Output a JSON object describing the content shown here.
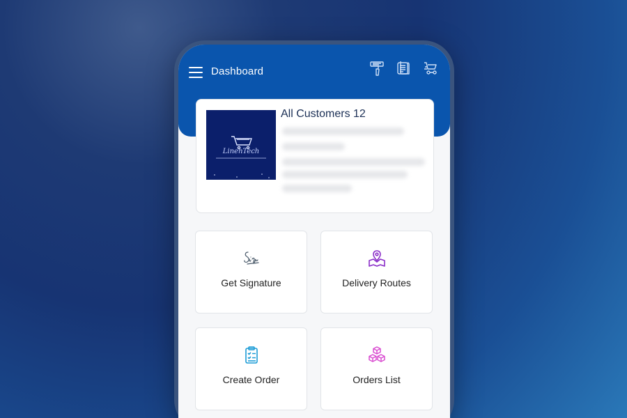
{
  "header": {
    "title": "Dashboard",
    "menu_icon": "hamburger-menu-icon",
    "actions": [
      {
        "name": "scanner-icon"
      },
      {
        "name": "notes-icon"
      },
      {
        "name": "delivery-truck-icon"
      }
    ]
  },
  "customer_card": {
    "title": "All Customers 12",
    "logo_text": "LinenTech"
  },
  "tiles": [
    {
      "label": "Get Signature",
      "icon": "signature-icon",
      "color": "#4a5a6a"
    },
    {
      "label": "Delivery Routes",
      "icon": "map-pin-icon",
      "color": "#8b2fc9"
    },
    {
      "label": "Create Order",
      "icon": "clipboard-icon",
      "color": "#1a9bd6"
    },
    {
      "label": "Orders List",
      "icon": "boxes-icon",
      "color": "#d94bd0"
    }
  ],
  "colors": {
    "header_bg": "#0a55ad",
    "screen_bg": "#f6f7f9"
  }
}
